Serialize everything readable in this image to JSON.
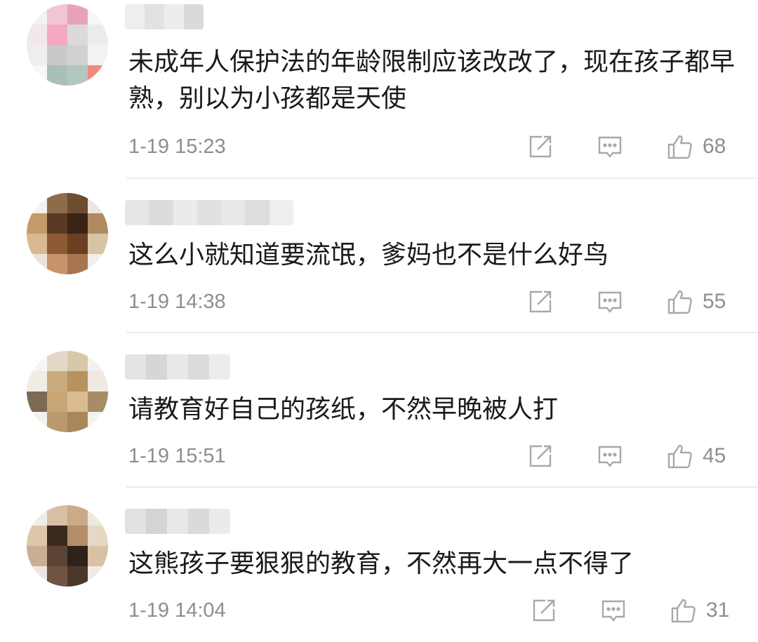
{
  "comments": [
    {
      "text": "未成年人保护法的年龄限制应该改改了，现在孩子都早熟，别以为小孩都是天使",
      "time": "1-19 15:23",
      "likes": "68"
    },
    {
      "text": "这么小就知道要流氓，爹妈也不是什么好鸟",
      "time": "1-19 14:38",
      "likes": "55"
    },
    {
      "text": "请教育好自己的孩纸，不然早晚被人打",
      "time": "1-19 15:51",
      "likes": "45"
    },
    {
      "text": "这熊孩子要狠狠的教育，不然再大一点不得了",
      "time": "1-19 14:04",
      "likes": "31"
    }
  ],
  "icons": {
    "share": "share-icon",
    "reply": "comment-icon",
    "like": "thumbs-up-icon"
  },
  "colors": {
    "text": "#1a1a1a",
    "meta": "#8e8e8e",
    "icon": "#a8a8a8",
    "divider": "#ececec"
  }
}
